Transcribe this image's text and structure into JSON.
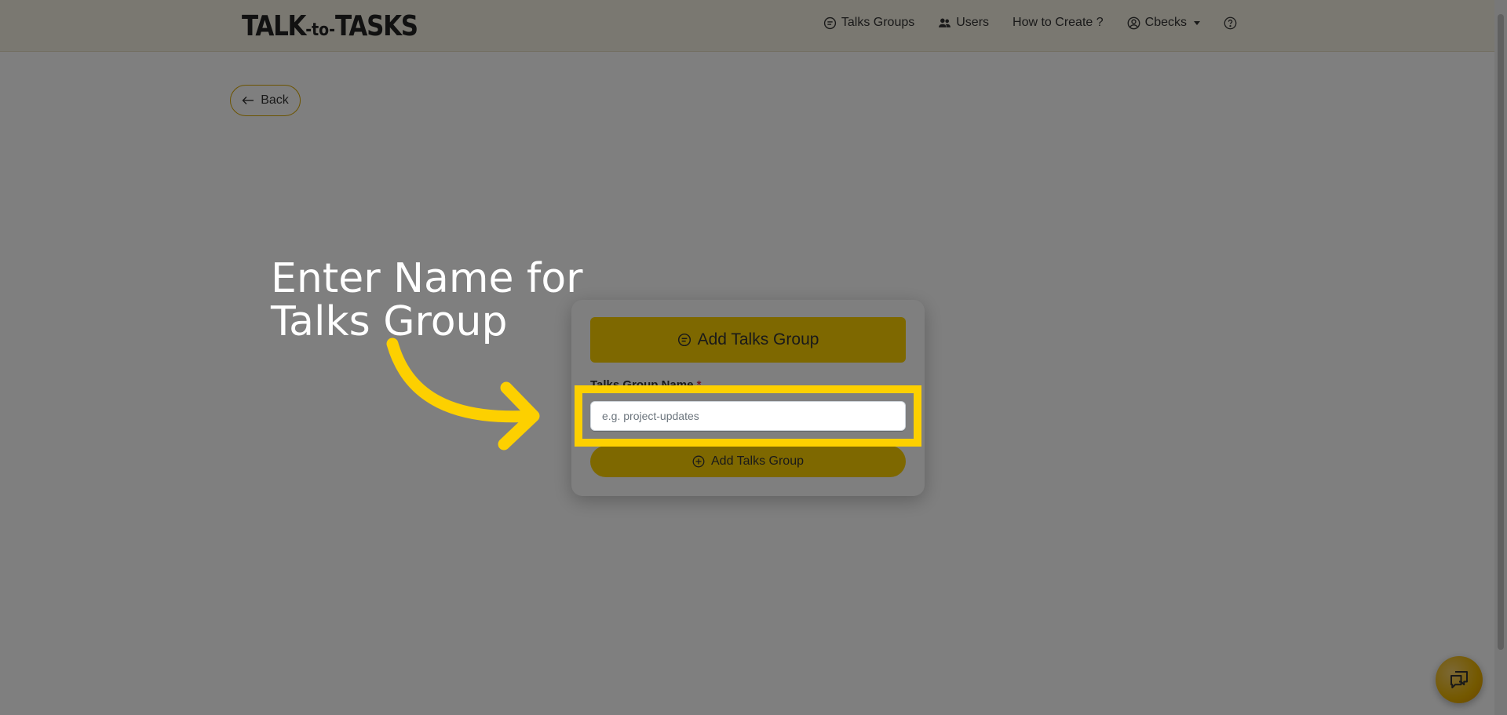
{
  "app": {
    "logo": {
      "left": "TALK",
      "mid": "-to-",
      "right": "TASKS"
    }
  },
  "nav": {
    "items": [
      {
        "label": "Talks Groups",
        "icon": "chat-circle-icon"
      },
      {
        "label": "Users",
        "icon": "users-icon"
      },
      {
        "label": "How to Create ?",
        "icon": ""
      },
      {
        "label": "Cbecks",
        "icon": "user-circle-icon"
      }
    ],
    "help_icon": "question-circle-icon"
  },
  "back_button": {
    "label": "Back",
    "icon": "arrow-left-icon"
  },
  "modal": {
    "title": "Add Talks Group",
    "field_label": "Talks Group Name",
    "required_mark": "*",
    "input_placeholder": "e.g. project-updates",
    "input_value": "",
    "submit_label": "Add Talks Group"
  },
  "annotation": {
    "text_line1": "Enter Name for",
    "text_line2": "Talks Group"
  },
  "colors": {
    "accent": "#fdd000",
    "overlay": "rgba(0,0,0,0.5)"
  }
}
